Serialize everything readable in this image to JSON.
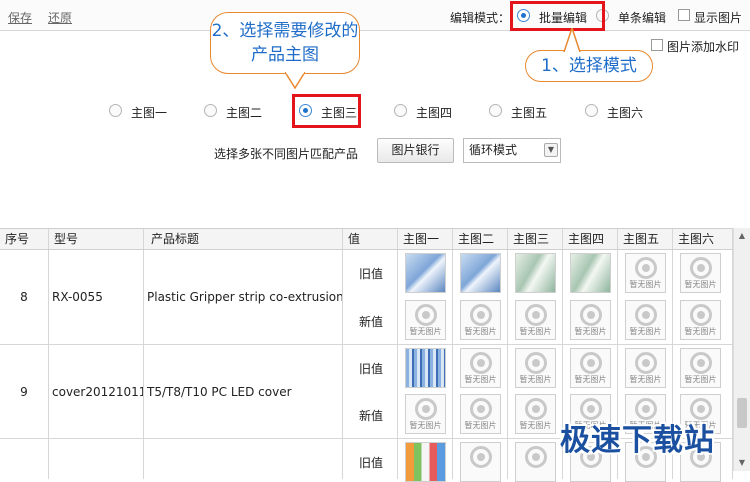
{
  "toolbar": {
    "save": "保存",
    "restore": "还原"
  },
  "edit_mode": {
    "label": "编辑模式：",
    "batch": "批量编辑",
    "single": "单条编辑",
    "show_images": "显示图片",
    "watermark": "图片添加水印"
  },
  "callouts": {
    "step1": "1、选择模式",
    "step2": "2、选择需要修改的产品主图"
  },
  "main_images": [
    "主图一",
    "主图二",
    "主图三",
    "主图四",
    "主图五",
    "主图六"
  ],
  "selected_main_image": "主图三",
  "match": {
    "label": "选择多张不同图片匹配产品",
    "bank_button": "图片银行",
    "mode_value": "循环模式"
  },
  "table": {
    "headers": [
      "序号",
      "型号",
      "产品标题",
      "值",
      "主图一",
      "主图二",
      "主图三",
      "主图四",
      "主图五",
      "主图六"
    ],
    "old_label": "旧值",
    "new_label": "新值",
    "no_image_text": "暂无图片",
    "rows": [
      {
        "no": "8",
        "model": "RX-0055",
        "title": "Plastic Gripper strip co-extrusion"
      },
      {
        "no": "9",
        "model": "cover20121011",
        "title": "T5/T8/T10 PC LED cover"
      },
      {
        "no": "",
        "model": "",
        "title": ""
      }
    ]
  },
  "watermark_text": "极速下载站"
}
